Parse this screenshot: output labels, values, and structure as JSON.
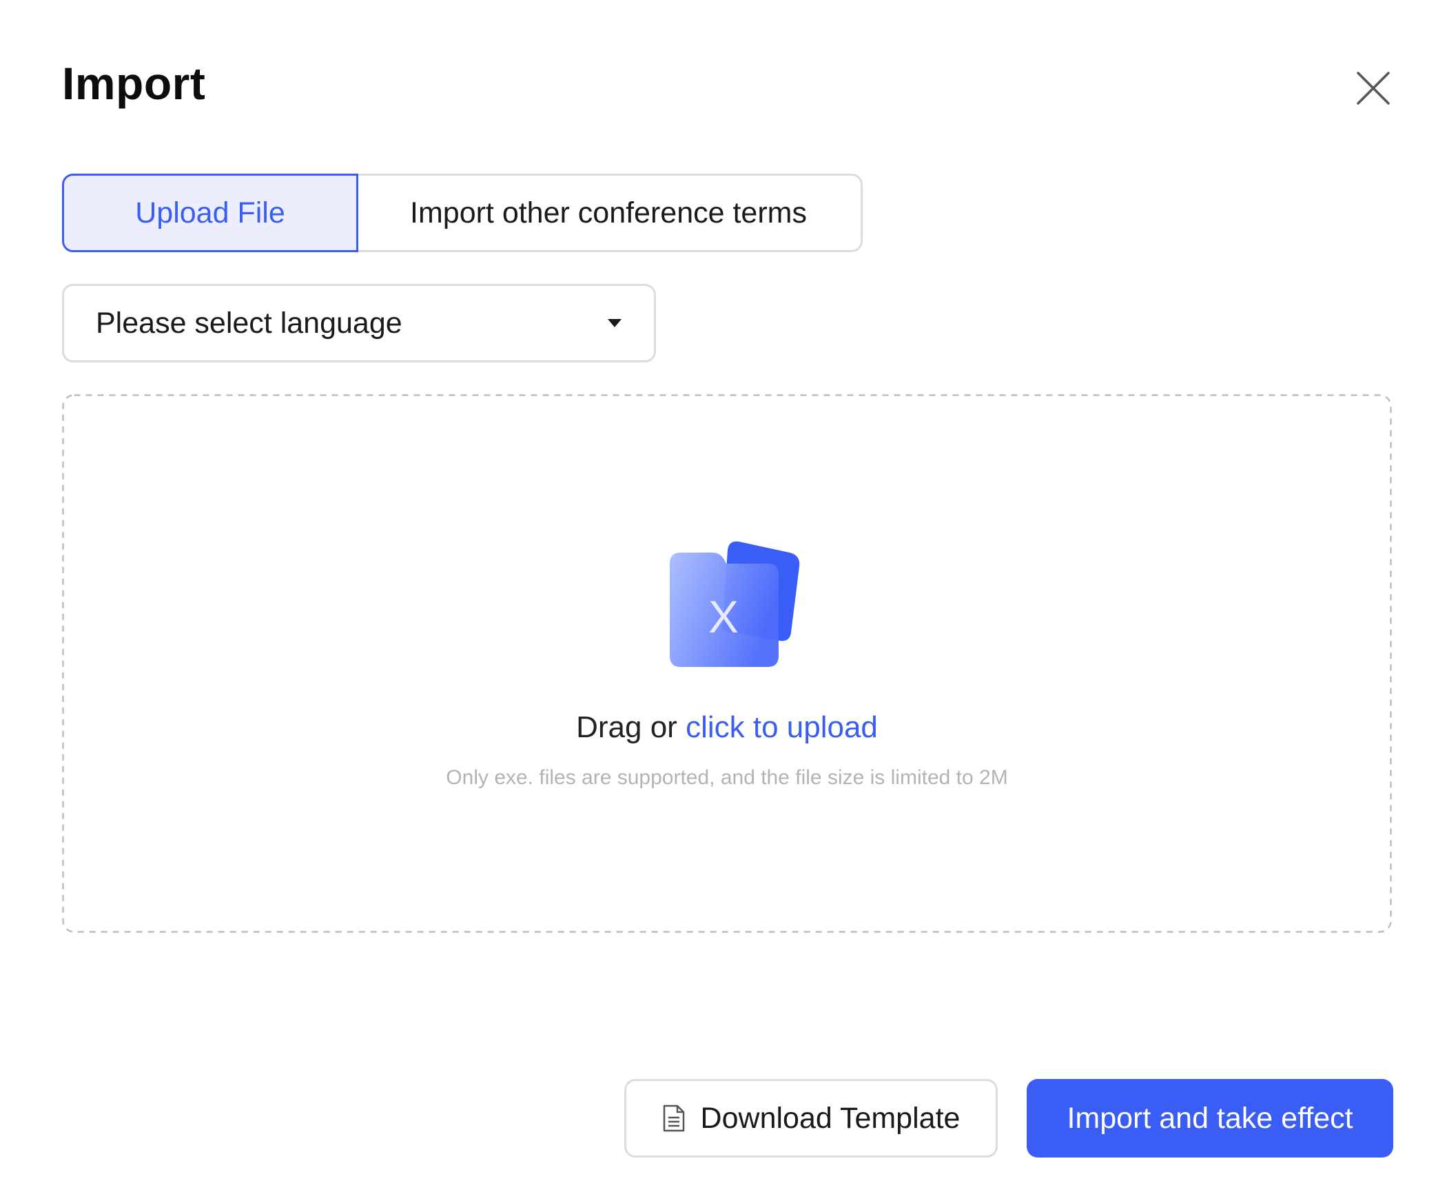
{
  "dialog": {
    "title": "Import",
    "close_icon": "close-icon"
  },
  "tabs": [
    {
      "label": "Upload File",
      "active": true
    },
    {
      "label": "Import other conference terms",
      "active": false
    }
  ],
  "language_select": {
    "placeholder": "Please select language",
    "icon": "caret-down-icon"
  },
  "upload": {
    "icon": "excel-folder-icon",
    "icon_letter": "X",
    "drag_prefix": "Drag or ",
    "click_link": "click to upload",
    "hint": "Only exe. files are supported, and the file size is limited to 2M"
  },
  "actions": {
    "download_template_label": "Download Template",
    "download_template_icon": "document-icon",
    "import_label": "Import and take effect"
  },
  "colors": {
    "accent": "#3a5df5",
    "accent_light": "#eceefe",
    "border": "#dcdcdc",
    "hint": "#b3b3b3"
  }
}
